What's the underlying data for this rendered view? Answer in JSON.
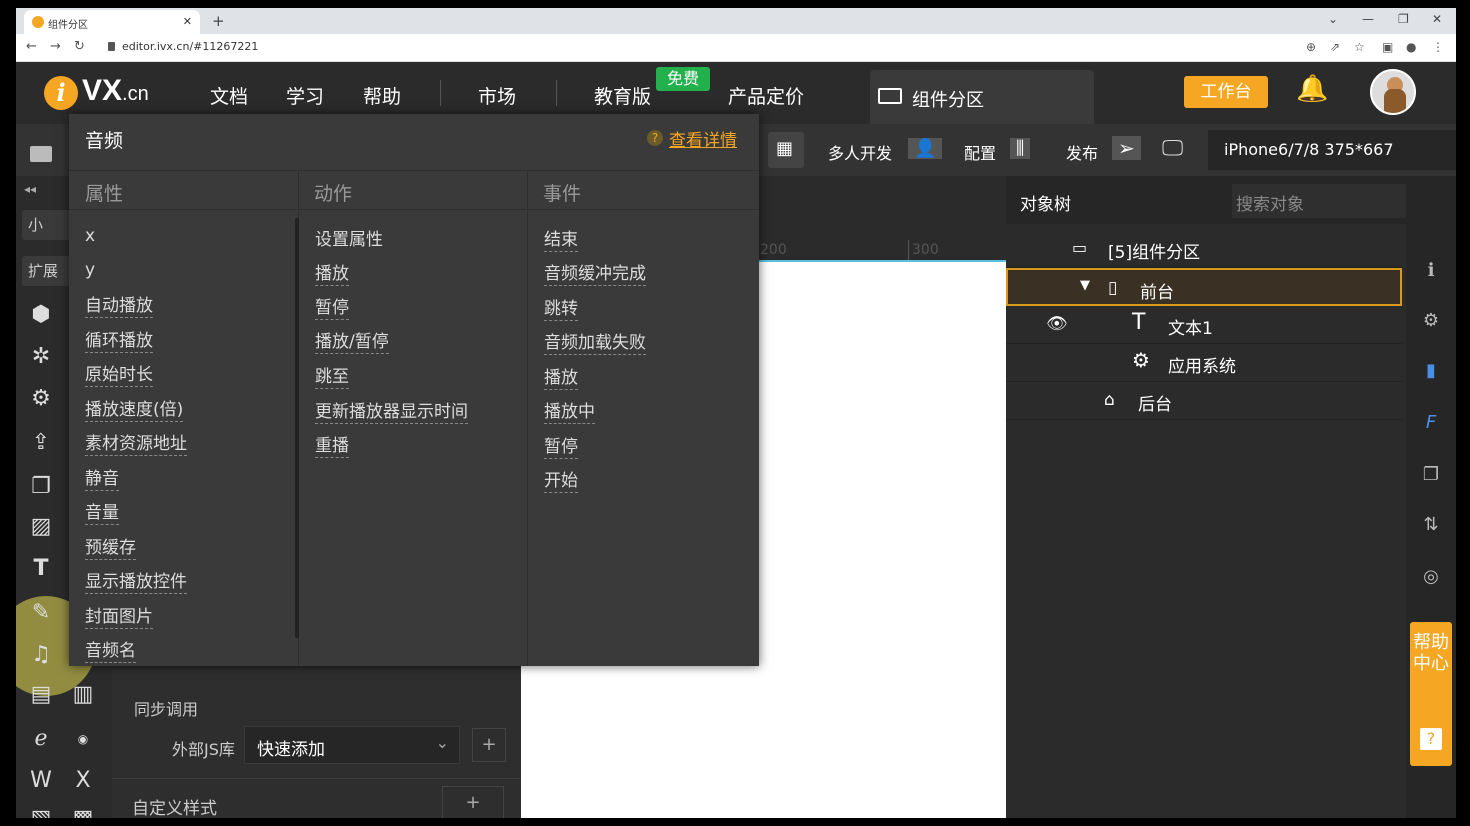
{
  "browser": {
    "tab_title": "组件分区",
    "url": "editor.ivx.cn/#11267221"
  },
  "header": {
    "logo_text": "VX",
    "logo_suffix": ".cn",
    "logo_i": "i",
    "nav": [
      "文档",
      "学习",
      "帮助",
      "市场",
      "教育版",
      "产品定价"
    ],
    "free_badge": "免费",
    "active_tab": "组件分区",
    "workbench": "工作台",
    "accent_color": "#f5a623"
  },
  "toolbar": {
    "multi_dev": "多人开发",
    "config": "配置",
    "publish": "发布",
    "device": "iPhone6/7/8 375*667"
  },
  "leftbar": {
    "tab1": "小",
    "tab2": "扩展"
  },
  "popup": {
    "title": "音频",
    "help_link": "查看详情",
    "columns": {
      "attributes": "属性",
      "actions": "动作",
      "events": "事件"
    },
    "attributes": [
      "x",
      "y",
      "自动播放",
      "循环播放",
      "原始时长",
      "播放速度(倍)",
      "素材资源地址",
      "静音",
      "音量",
      "预缓存",
      "显示播放控件",
      "封面图片",
      "音频名"
    ],
    "actions": [
      "设置属性",
      "播放",
      "暂停",
      "播放/暂停",
      "跳至",
      "更新播放器显示时间",
      "重播"
    ],
    "events": [
      "结束",
      "音频缓冲完成",
      "跳转",
      "音频加载失败",
      "播放",
      "播放中",
      "暂停",
      "开始"
    ]
  },
  "properties": {
    "sync_call": "同步调用",
    "external_js": "外部JS库",
    "quick_add": "快速添加",
    "custom_style": "自定义样式",
    "plus": "+"
  },
  "ruler": {
    "t1": "200",
    "t2": "300"
  },
  "tree": {
    "title": "对象树",
    "search_placeholder": "搜索对象",
    "nodes": [
      {
        "label": "[5]组件分区"
      },
      {
        "label": "前台"
      },
      {
        "label": "文本1"
      },
      {
        "label": "应用系统"
      },
      {
        "label": "后台"
      }
    ]
  },
  "help_center": {
    "label": "帮助中心",
    "q": "?"
  }
}
